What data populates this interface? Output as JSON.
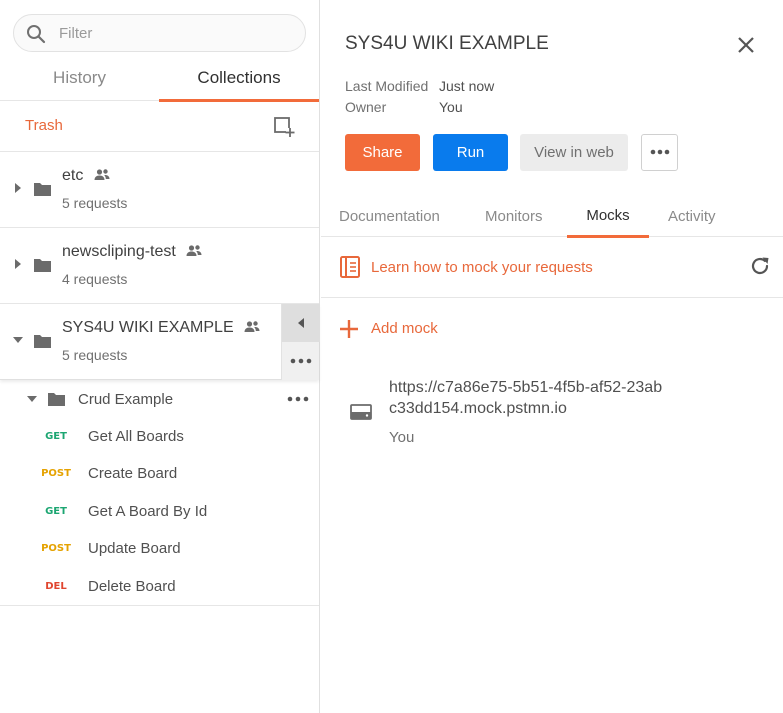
{
  "sidebar": {
    "search": {
      "placeholder": "Filter",
      "value": ""
    },
    "tabs": [
      {
        "label": "History",
        "active": false
      },
      {
        "label": "Collections",
        "active": true
      }
    ],
    "trash_label": "Trash",
    "collections": [
      {
        "name": "etc",
        "meta": "5 requests",
        "shared": true,
        "expanded": false
      },
      {
        "name": "newscliping-test",
        "meta": "4 requests",
        "shared": true,
        "expanded": false
      },
      {
        "name": "SYS4U WIKI EXAMPLE",
        "meta": "5 requests",
        "shared": true,
        "expanded": true
      }
    ],
    "folder": {
      "name": "Crud Example",
      "requests": [
        {
          "method": "GET",
          "name": "Get All Boards"
        },
        {
          "method": "POST",
          "name": "Create Board"
        },
        {
          "method": "GET",
          "name": "Get A Board By Id"
        },
        {
          "method": "POST",
          "name": "Update Board"
        },
        {
          "method": "DEL",
          "name": "Delete Board"
        }
      ]
    }
  },
  "panel": {
    "title": "SYS4U WIKI EXAMPLE",
    "last_modified_label": "Last Modified",
    "last_modified_value": "Just now",
    "owner_label": "Owner",
    "owner_value": "You",
    "buttons": {
      "share": "Share",
      "run": "Run",
      "view_web": "View in web"
    },
    "tabs": [
      {
        "label": "Documentation",
        "active": false
      },
      {
        "label": "Monitors",
        "active": false
      },
      {
        "label": "Mocks",
        "active": true
      },
      {
        "label": "Activity",
        "active": false
      }
    ],
    "learn_link": "Learn how to mock your requests",
    "add_mock": "Add mock",
    "mock": {
      "url": "https://c7a86e75-5b51-4f5b-af52-23abc33dd154.mock.pstmn.io",
      "owner": "You"
    }
  },
  "colors": {
    "accent": "#f26b3a",
    "link": "#e8683b",
    "primary": "#097bed",
    "get": "#1ca672",
    "post": "#e5a200",
    "delete": "#e0452f"
  },
  "icons": [
    "search-icon",
    "new-collection-icon",
    "caret-right-icon",
    "caret-down-icon",
    "folder-icon",
    "team-icon",
    "collapse-left-icon",
    "more-icon",
    "close-icon",
    "book-icon",
    "refresh-icon",
    "plus-icon",
    "server-icon"
  ]
}
